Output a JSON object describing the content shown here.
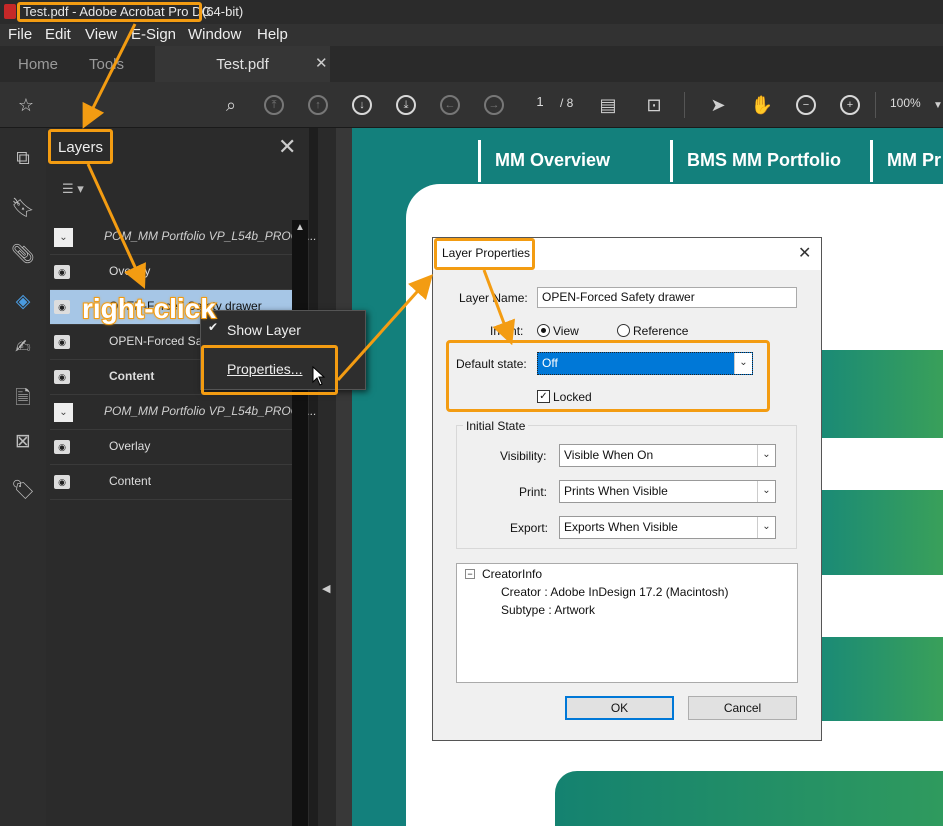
{
  "window": {
    "title": "Test.pdf - Adobe Acrobat Pro DC",
    "title_suffix": "(64-bit)"
  },
  "menu": [
    "File",
    "Edit",
    "View",
    "E-Sign",
    "Window",
    "Help"
  ],
  "tabs": {
    "home": "Home",
    "tools": "Tools",
    "document": "Test.pdf"
  },
  "toolbar": {
    "page_current": "1",
    "page_total": "/ 8",
    "zoom": "100%"
  },
  "layers_panel": {
    "title": "Layers",
    "rows": [
      {
        "label": "POM_MM Portfolio VP_L54b_PROG1...",
        "kind": "group"
      },
      {
        "label": "Overlay",
        "kind": "layer"
      },
      {
        "label": "OPEN-Forced Safety drawer",
        "kind": "layer",
        "selected": true
      },
      {
        "label": "OPEN-Forced Safety",
        "kind": "layer"
      },
      {
        "label": "Content",
        "kind": "layer",
        "bold": true
      },
      {
        "label": "POM_MM Portfolio VP_L54b_PROG1...",
        "kind": "group"
      },
      {
        "label": "Overlay",
        "kind": "layer"
      },
      {
        "label": "Content",
        "kind": "layer"
      }
    ]
  },
  "context_menu": {
    "show_layer": "Show Layer",
    "properties": "Properties..."
  },
  "annotation": {
    "right_click": "right-click"
  },
  "document": {
    "nav": [
      "MM Overview",
      "BMS MM Portfolio",
      "MM Pr"
    ]
  },
  "dialog": {
    "title": "Layer Properties",
    "layer_name_label": "Layer Name:",
    "layer_name_value": "OPEN-Forced Safety drawer",
    "intent_label": "Intent:",
    "intent_view": "View",
    "intent_reference": "Reference",
    "default_state_label": "Default state:",
    "default_state_value": "Off",
    "locked_label": "Locked",
    "initial_state_label": "Initial State",
    "visibility_label": "Visibility:",
    "visibility_value": "Visible When On",
    "print_label": "Print:",
    "print_value": "Prints When Visible",
    "export_label": "Export:",
    "export_value": "Exports When Visible",
    "info_root": "CreatorInfo",
    "info_creator": "Creator : Adobe InDesign 17.2 (Macintosh)",
    "info_subtype": "Subtype : Artwork",
    "ok": "OK",
    "cancel": "Cancel"
  },
  "colors": {
    "highlight": "#f39c12",
    "selection": "#a6c6e6",
    "doc_teal": "#13807c",
    "focus": "#0078d7"
  }
}
